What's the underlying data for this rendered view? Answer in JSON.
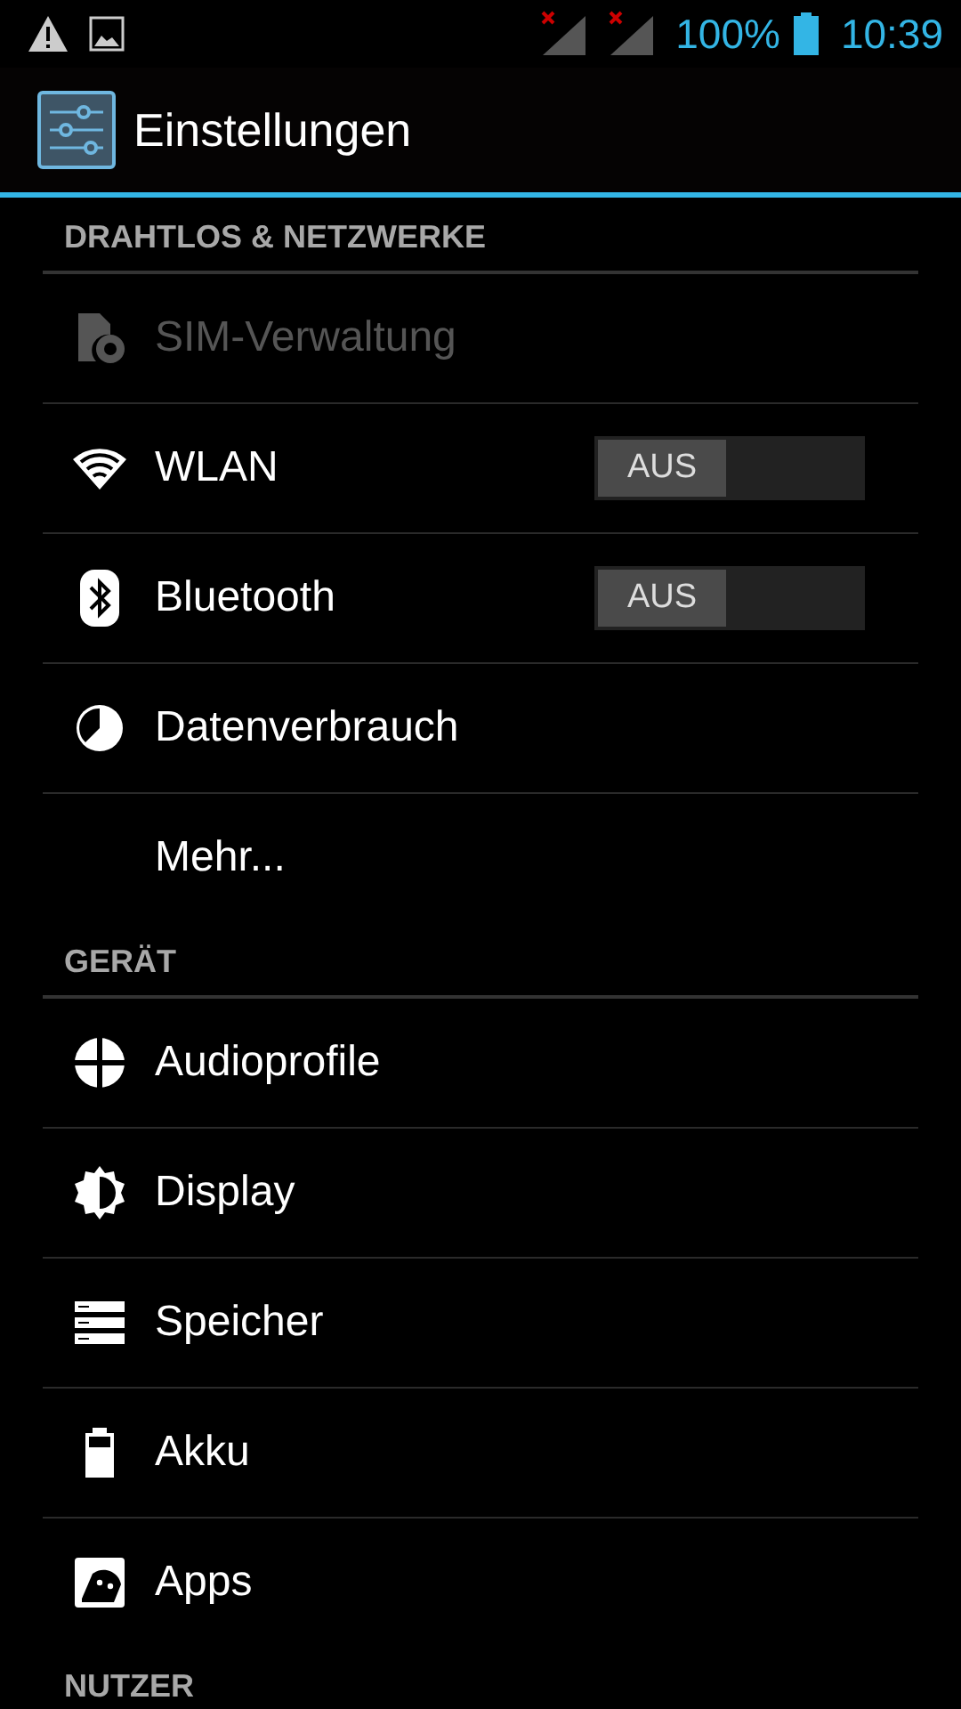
{
  "status_bar": {
    "battery": "100%",
    "time": "10:39"
  },
  "action_bar": {
    "title": "Einstellungen"
  },
  "sections": [
    {
      "header": "DRAHTLOS & NETZWERKE",
      "items": [
        {
          "label": "SIM-Verwaltung",
          "kind": "plain",
          "disabled": true
        },
        {
          "label": "WLAN",
          "kind": "toggle",
          "disabled": false,
          "switch": {
            "label": "AUS",
            "on": false
          }
        },
        {
          "label": "Bluetooth",
          "kind": "toggle",
          "disabled": false,
          "switch": {
            "label": "AUS",
            "on": false
          }
        },
        {
          "label": "Datenverbrauch",
          "kind": "plain",
          "disabled": false
        },
        {
          "label": "Mehr...",
          "kind": "plain",
          "disabled": false
        }
      ]
    },
    {
      "header": "GERÄT",
      "items": [
        {
          "label": "Audioprofile",
          "kind": "plain",
          "disabled": false
        },
        {
          "label": "Display",
          "kind": "plain",
          "disabled": false
        },
        {
          "label": "Speicher",
          "kind": "plain",
          "disabled": false
        },
        {
          "label": "Akku",
          "kind": "plain",
          "disabled": false
        },
        {
          "label": "Apps",
          "kind": "plain",
          "disabled": false
        }
      ]
    },
    {
      "header": "NUTZER"
    }
  ]
}
